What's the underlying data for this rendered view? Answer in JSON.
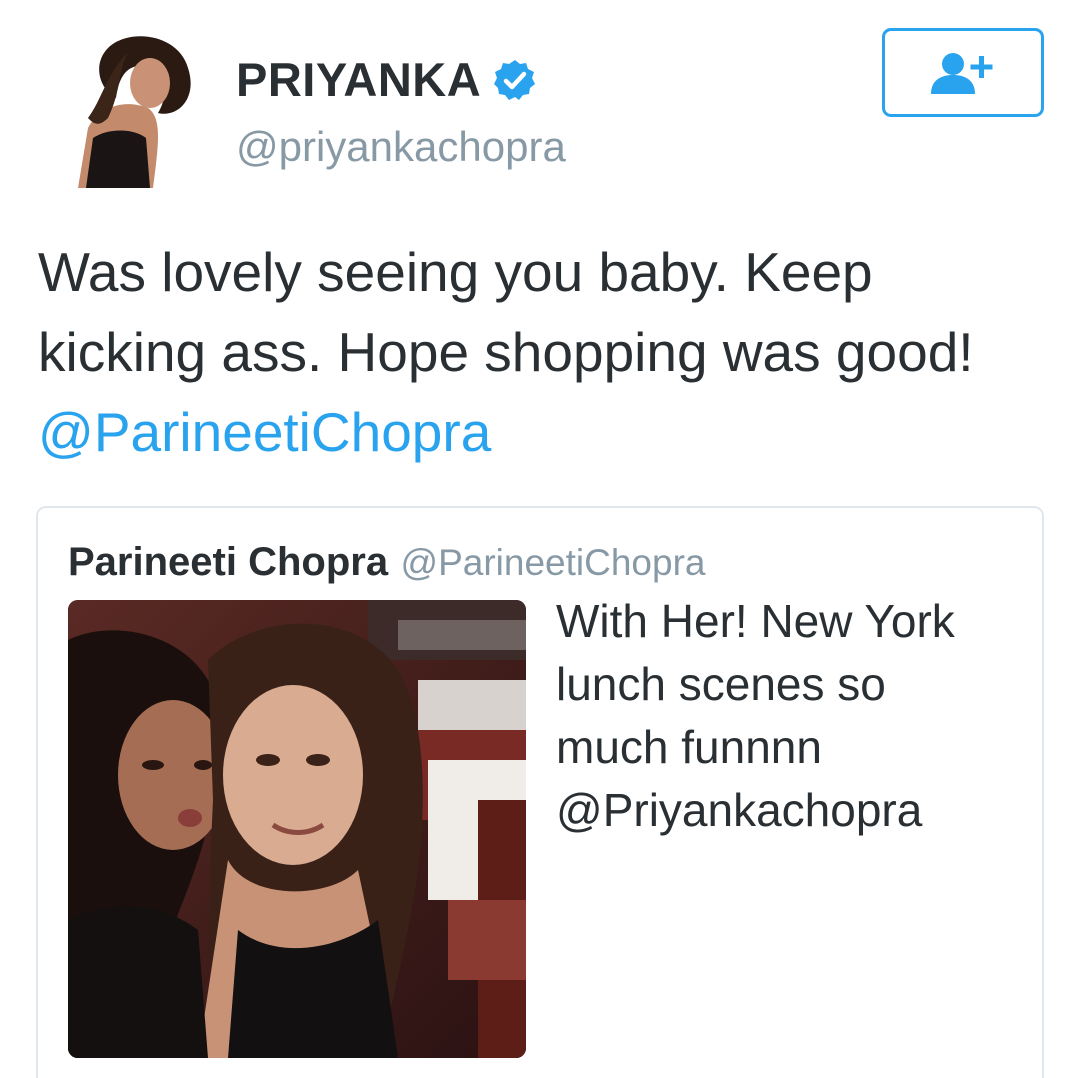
{
  "tweet": {
    "author": {
      "display_name": "PRIYANKA",
      "handle": "@priyankachopra",
      "verified": true
    },
    "text_lines": [
      "Was lovely seeing you baby. Keep",
      "kicking ass. Hope shopping was good!"
    ],
    "mention": "@ParineetiChopra",
    "follow_icon": "add-user-icon"
  },
  "quoted_tweet": {
    "author_name": "Parineeti Chopra",
    "author_handle": "@ParineetiChopra",
    "text_lines": [
      "With Her! New York",
      "lunch scenes so",
      "much funnnn",
      "@Priyankachopra"
    ]
  },
  "colors": {
    "accent": "#2aa3ef",
    "text": "#292f33",
    "muted": "#8899a6",
    "border": "#e1e8ed"
  }
}
